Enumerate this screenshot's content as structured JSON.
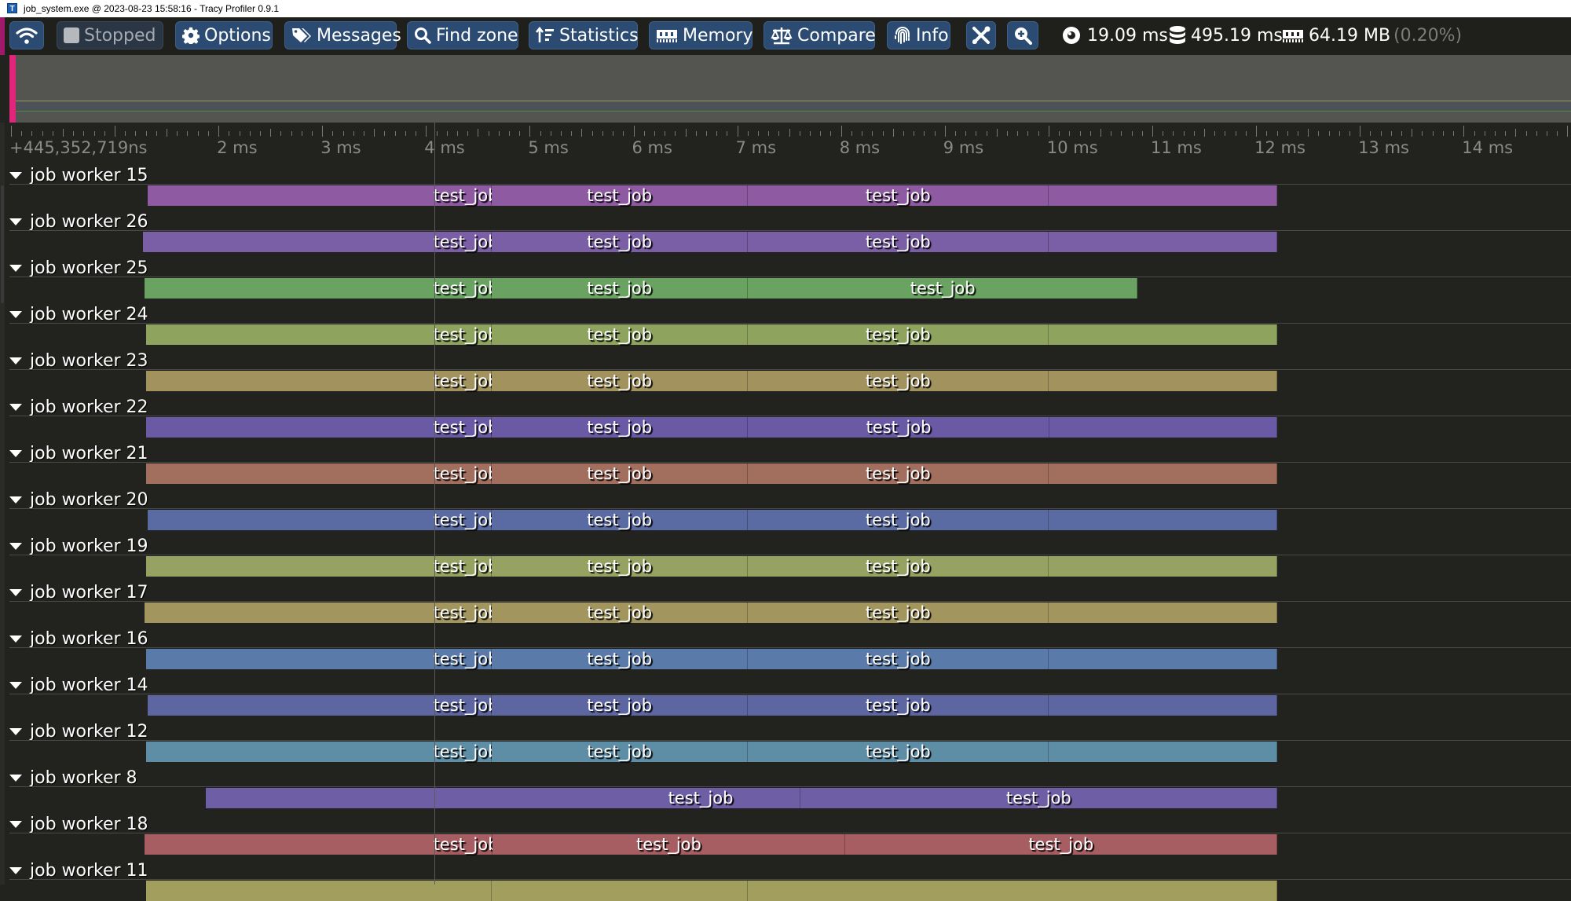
{
  "window": {
    "title": "job_system.exe @ 2023-08-23 15:58:16 - Tracy Profiler 0.9.1",
    "app_icon": "T"
  },
  "toolbar": {
    "buttons": [
      {
        "id": "connection",
        "icon": "wifi-icon",
        "label": ""
      },
      {
        "id": "stopped",
        "icon": "stop-square-icon",
        "label": "Stopped",
        "disabled": true
      },
      {
        "id": "options",
        "icon": "gear-icon",
        "label": "Options"
      },
      {
        "id": "messages",
        "icon": "tags-icon",
        "label": "Messages"
      },
      {
        "id": "find-zone",
        "icon": "search-icon",
        "label": "Find zone"
      },
      {
        "id": "statistics",
        "icon": "sort-amount-icon",
        "label": "Statistics"
      },
      {
        "id": "memory",
        "icon": "memory-icon",
        "label": "Memory"
      },
      {
        "id": "compare",
        "icon": "scale-balance-icon",
        "label": "Compare"
      },
      {
        "id": "info",
        "icon": "fingerprint-icon",
        "label": "Info"
      },
      {
        "id": "tools",
        "icon": "tools-icon",
        "label": ""
      },
      {
        "id": "zoom",
        "icon": "zoom-in-icon",
        "label": ""
      }
    ],
    "stats": {
      "view_time": "19.09 ms",
      "total_time": "495.19 ms",
      "memory": "64.19 MB",
      "memory_percent": "(0.20%)"
    }
  },
  "timeline": {
    "start_label": "+445,352,719ns",
    "ticks": [
      "2 ms",
      "3 ms",
      "4 ms",
      "5 ms",
      "6 ms",
      "7 ms",
      "8 ms",
      "9 ms",
      "10 ms",
      "11 ms",
      "12 ms",
      "13 ms",
      "14 ms"
    ],
    "zone_name": "test_job",
    "threads": [
      {
        "name": "job worker 15",
        "color": "#8e5aa2",
        "zones": [
          [
            1.32,
            4.63
          ],
          [
            4.63,
            7.1
          ],
          [
            7.1,
            10.0
          ],
          [
            10.0,
            12.2
          ]
        ],
        "labels": [
          1,
          1,
          1,
          0
        ]
      },
      {
        "name": "job worker 26",
        "color": "#7a5ea6",
        "zones": [
          [
            1.27,
            4.63
          ],
          [
            4.63,
            7.1
          ],
          [
            7.1,
            10.0
          ],
          [
            10.0,
            12.2
          ]
        ],
        "labels": [
          1,
          1,
          1,
          0
        ]
      },
      {
        "name": "job worker 25",
        "color": "#6aa262",
        "zones": [
          [
            1.29,
            4.63
          ],
          [
            4.63,
            7.1
          ],
          [
            7.1,
            10.86
          ]
        ],
        "labels": [
          1,
          1,
          1
        ]
      },
      {
        "name": "job worker 24",
        "color": "#8ea45e",
        "zones": [
          [
            1.3,
            4.63
          ],
          [
            4.63,
            7.1
          ],
          [
            7.1,
            10.0
          ],
          [
            10.0,
            12.2
          ]
        ],
        "labels": [
          1,
          1,
          1,
          0
        ]
      },
      {
        "name": "job worker 23",
        "color": "#a2925e",
        "zones": [
          [
            1.3,
            4.63
          ],
          [
            4.63,
            7.1
          ],
          [
            7.1,
            10.0
          ],
          [
            10.0,
            12.2
          ]
        ],
        "labels": [
          1,
          1,
          1,
          0
        ]
      },
      {
        "name": "job worker 22",
        "color": "#6a5aa6",
        "zones": [
          [
            1.3,
            4.63
          ],
          [
            4.63,
            7.1
          ],
          [
            7.1,
            10.01
          ],
          [
            10.01,
            12.2
          ]
        ],
        "labels": [
          1,
          1,
          1,
          0
        ]
      },
      {
        "name": "job worker 21",
        "color": "#a26e5e",
        "zones": [
          [
            1.3,
            4.63
          ],
          [
            4.63,
            7.1
          ],
          [
            7.1,
            10.0
          ],
          [
            10.0,
            12.2
          ]
        ],
        "labels": [
          1,
          1,
          1,
          0
        ]
      },
      {
        "name": "job worker 20",
        "color": "#5a6aa2",
        "zones": [
          [
            1.32,
            4.63
          ],
          [
            4.63,
            7.1
          ],
          [
            7.1,
            10.0
          ],
          [
            10.0,
            12.2
          ]
        ],
        "labels": [
          1,
          1,
          1,
          0
        ]
      },
      {
        "name": "job worker 19",
        "color": "#96a262",
        "zones": [
          [
            1.3,
            4.63
          ],
          [
            4.63,
            7.1
          ],
          [
            7.1,
            10.0
          ],
          [
            10.0,
            12.2
          ]
        ],
        "labels": [
          1,
          1,
          1,
          0
        ]
      },
      {
        "name": "job worker 17",
        "color": "#a2965e",
        "zones": [
          [
            1.29,
            4.63
          ],
          [
            4.63,
            7.1
          ],
          [
            7.1,
            10.0
          ],
          [
            10.0,
            12.2
          ]
        ],
        "labels": [
          1,
          1,
          1,
          0
        ]
      },
      {
        "name": "job worker 16",
        "color": "#5a7aaa",
        "zones": [
          [
            1.3,
            4.63
          ],
          [
            4.63,
            7.1
          ],
          [
            7.1,
            10.0
          ],
          [
            10.0,
            12.2
          ]
        ],
        "labels": [
          1,
          1,
          1,
          0
        ]
      },
      {
        "name": "job worker 14",
        "color": "#5e66a2",
        "zones": [
          [
            1.32,
            4.63
          ],
          [
            4.63,
            7.1
          ],
          [
            7.1,
            10.0
          ],
          [
            10.0,
            12.2
          ]
        ],
        "labels": [
          1,
          1,
          1,
          0
        ]
      },
      {
        "name": "job worker 12",
        "color": "#5e8ea6",
        "zones": [
          [
            1.3,
            4.63
          ],
          [
            4.63,
            7.1
          ],
          [
            7.1,
            10.0
          ],
          [
            10.0,
            12.2
          ]
        ],
        "labels": [
          1,
          1,
          1,
          0
        ]
      },
      {
        "name": "job worker 8",
        "color": "#6e5ea6",
        "zones": [
          [
            1.88,
            7.61
          ],
          [
            7.61,
            12.2
          ]
        ],
        "labels": [
          1,
          1
        ]
      },
      {
        "name": "job worker 18",
        "color": "#a65e62",
        "zones": [
          [
            1.29,
            4.64
          ],
          [
            4.64,
            8.04
          ],
          [
            8.04,
            12.2
          ]
        ],
        "labels": [
          1,
          1,
          1
        ]
      },
      {
        "name": "job worker 11",
        "color": "#a29e5e",
        "zones": [
          [
            1.3,
            4.63
          ],
          [
            4.63,
            7.1
          ],
          [
            7.1,
            12.2
          ]
        ],
        "labels": [
          0,
          0,
          0
        ]
      }
    ]
  }
}
